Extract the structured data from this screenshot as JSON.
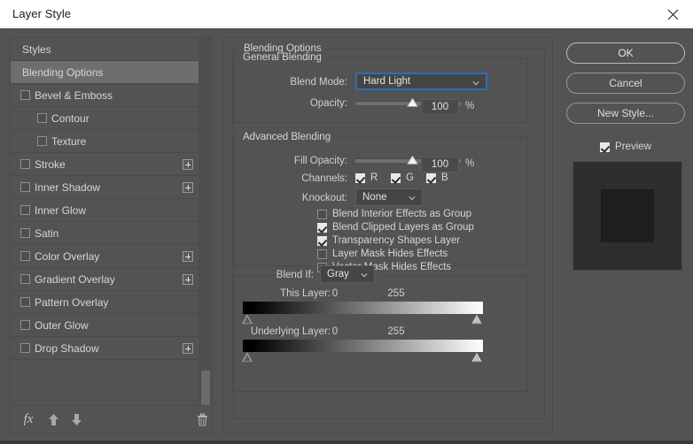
{
  "window": {
    "title": "Layer Style",
    "close_icon": "close-icon"
  },
  "styles_panel": {
    "items": [
      {
        "label": "Styles",
        "type": "header",
        "checkbox": false,
        "checked": false,
        "selected": false,
        "indent": 0,
        "plus": false
      },
      {
        "label": "Blending Options",
        "type": "header",
        "checkbox": false,
        "checked": false,
        "selected": true,
        "indent": 0,
        "plus": false
      },
      {
        "label": "Bevel & Emboss",
        "type": "effect",
        "checkbox": true,
        "checked": false,
        "selected": false,
        "indent": 1,
        "plus": false
      },
      {
        "label": "Contour",
        "type": "effect",
        "checkbox": true,
        "checked": false,
        "selected": false,
        "indent": 2,
        "plus": false
      },
      {
        "label": "Texture",
        "type": "effect",
        "checkbox": true,
        "checked": false,
        "selected": false,
        "indent": 2,
        "plus": false
      },
      {
        "label": "Stroke",
        "type": "effect",
        "checkbox": true,
        "checked": false,
        "selected": false,
        "indent": 1,
        "plus": true
      },
      {
        "label": "Inner Shadow",
        "type": "effect",
        "checkbox": true,
        "checked": false,
        "selected": false,
        "indent": 1,
        "plus": true
      },
      {
        "label": "Inner Glow",
        "type": "effect",
        "checkbox": true,
        "checked": false,
        "selected": false,
        "indent": 1,
        "plus": false
      },
      {
        "label": "Satin",
        "type": "effect",
        "checkbox": true,
        "checked": false,
        "selected": false,
        "indent": 1,
        "plus": false
      },
      {
        "label": "Color Overlay",
        "type": "effect",
        "checkbox": true,
        "checked": false,
        "selected": false,
        "indent": 1,
        "plus": true
      },
      {
        "label": "Gradient Overlay",
        "type": "effect",
        "checkbox": true,
        "checked": false,
        "selected": false,
        "indent": 1,
        "plus": true
      },
      {
        "label": "Pattern Overlay",
        "type": "effect",
        "checkbox": true,
        "checked": false,
        "selected": false,
        "indent": 1,
        "plus": false
      },
      {
        "label": "Outer Glow",
        "type": "effect",
        "checkbox": true,
        "checked": false,
        "selected": false,
        "indent": 1,
        "plus": false
      },
      {
        "label": "Drop Shadow",
        "type": "effect",
        "checkbox": true,
        "checked": false,
        "selected": false,
        "indent": 1,
        "plus": true
      }
    ],
    "toolbar": {
      "fx_label": "fx",
      "fx_icon": "fx-icon",
      "move_up_icon": "arrow-up-icon",
      "move_down_icon": "arrow-down-icon",
      "delete_icon": "trash-icon"
    }
  },
  "blending_options": {
    "group_label": "Blending Options",
    "general": {
      "group_label": "General Blending",
      "blend_mode_label": "Blend Mode:",
      "blend_mode_value": "Hard Light",
      "opacity_label": "Opacity:",
      "opacity_value": "100",
      "opacity_unit": "%",
      "opacity_percent": 100
    },
    "advanced": {
      "group_label": "Advanced Blending",
      "fill_opacity_label": "Fill Opacity:",
      "fill_opacity_value": "100",
      "fill_opacity_unit": "%",
      "fill_opacity_percent": 100,
      "channels_label": "Channels:",
      "channels": [
        {
          "label": "R",
          "checked": true
        },
        {
          "label": "G",
          "checked": true
        },
        {
          "label": "B",
          "checked": true
        }
      ],
      "knockout_label": "Knockout:",
      "knockout_value": "None",
      "checkboxes": [
        {
          "label": "Blend Interior Effects as Group",
          "checked": false
        },
        {
          "label": "Blend Clipped Layers as Group",
          "checked": true
        },
        {
          "label": "Transparency Shapes Layer",
          "checked": true
        },
        {
          "label": "Layer Mask Hides Effects",
          "checked": false
        },
        {
          "label": "Vector Mask Hides Effects",
          "checked": false
        }
      ]
    },
    "blend_if": {
      "label": "Blend If:",
      "channel_value": "Gray",
      "this_layer": {
        "label": "This Layer:",
        "min": "0",
        "max": "255"
      },
      "underlying_layer": {
        "label": "Underlying Layer:",
        "min": "0",
        "max": "255"
      }
    }
  },
  "actions": {
    "ok_label": "OK",
    "cancel_label": "Cancel",
    "new_style_label": "New Style...",
    "preview_label": "Preview",
    "preview_checked": true
  },
  "colors": {
    "dialog_bg": "#535353",
    "titlebar_bg": "#ffffff",
    "selected_row": "#6e6e6e",
    "focus_blue": "#2b6fb5",
    "text": "#d6d6d6"
  }
}
